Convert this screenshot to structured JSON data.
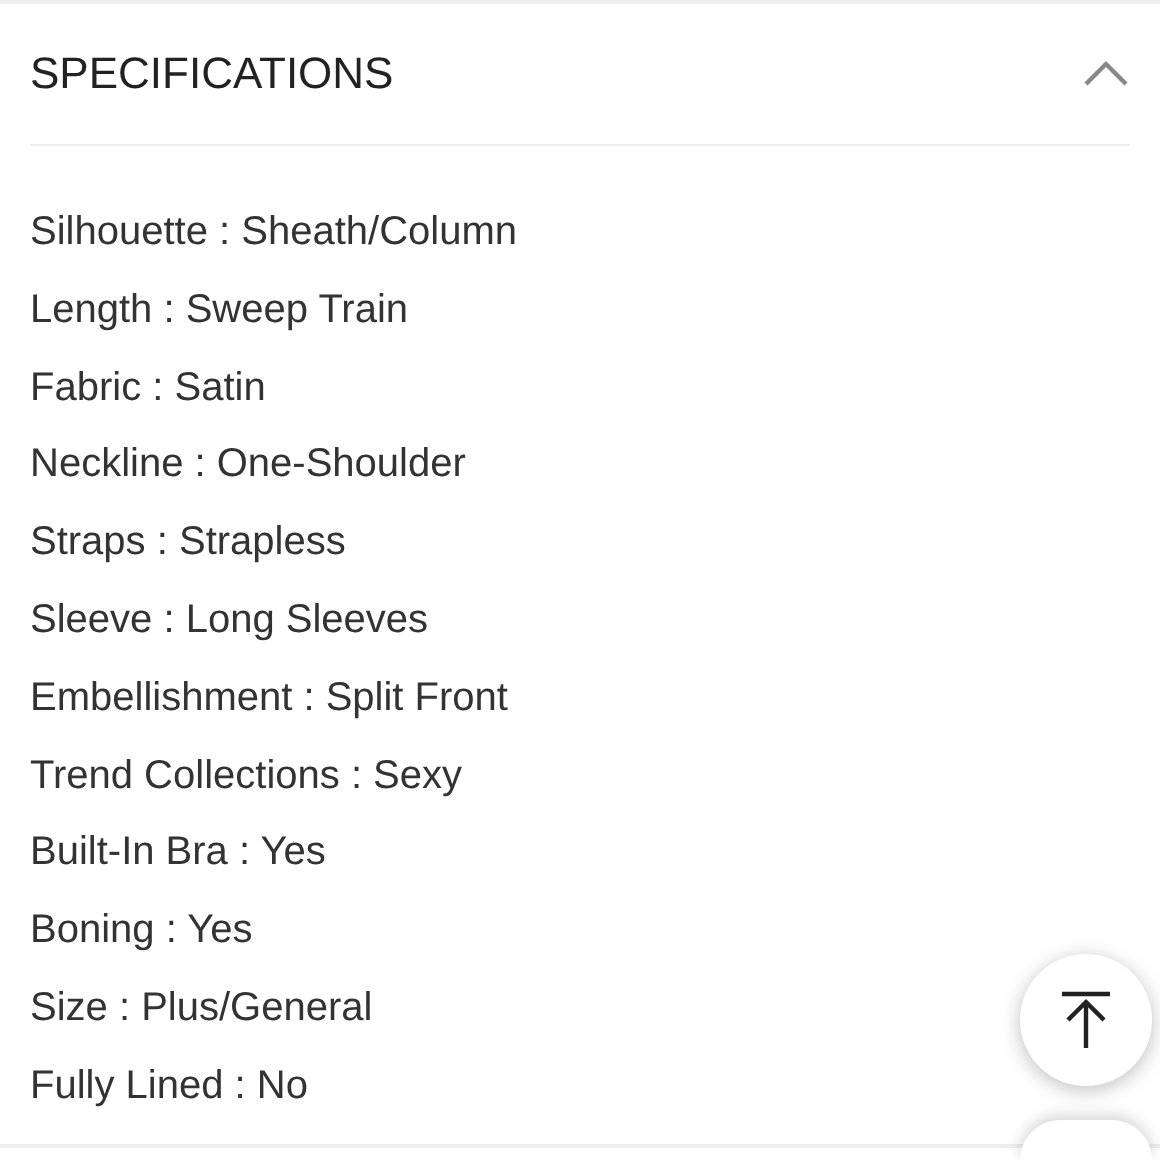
{
  "section": {
    "title": "SPECIFICATIONS",
    "expanded": true,
    "items": [
      "Silhouette : Sheath/Column",
      "Length : Sweep Train",
      "Fabric : Satin",
      "Neckline : One-Shoulder",
      "Straps : Strapless",
      "Sleeve : Long Sleeves",
      "Embellishment : Split Front",
      "Trend Collections : Sexy",
      "Built-In Bra : Yes",
      "Boning : Yes",
      "Size : Plus/General",
      "Fully Lined : No"
    ]
  }
}
